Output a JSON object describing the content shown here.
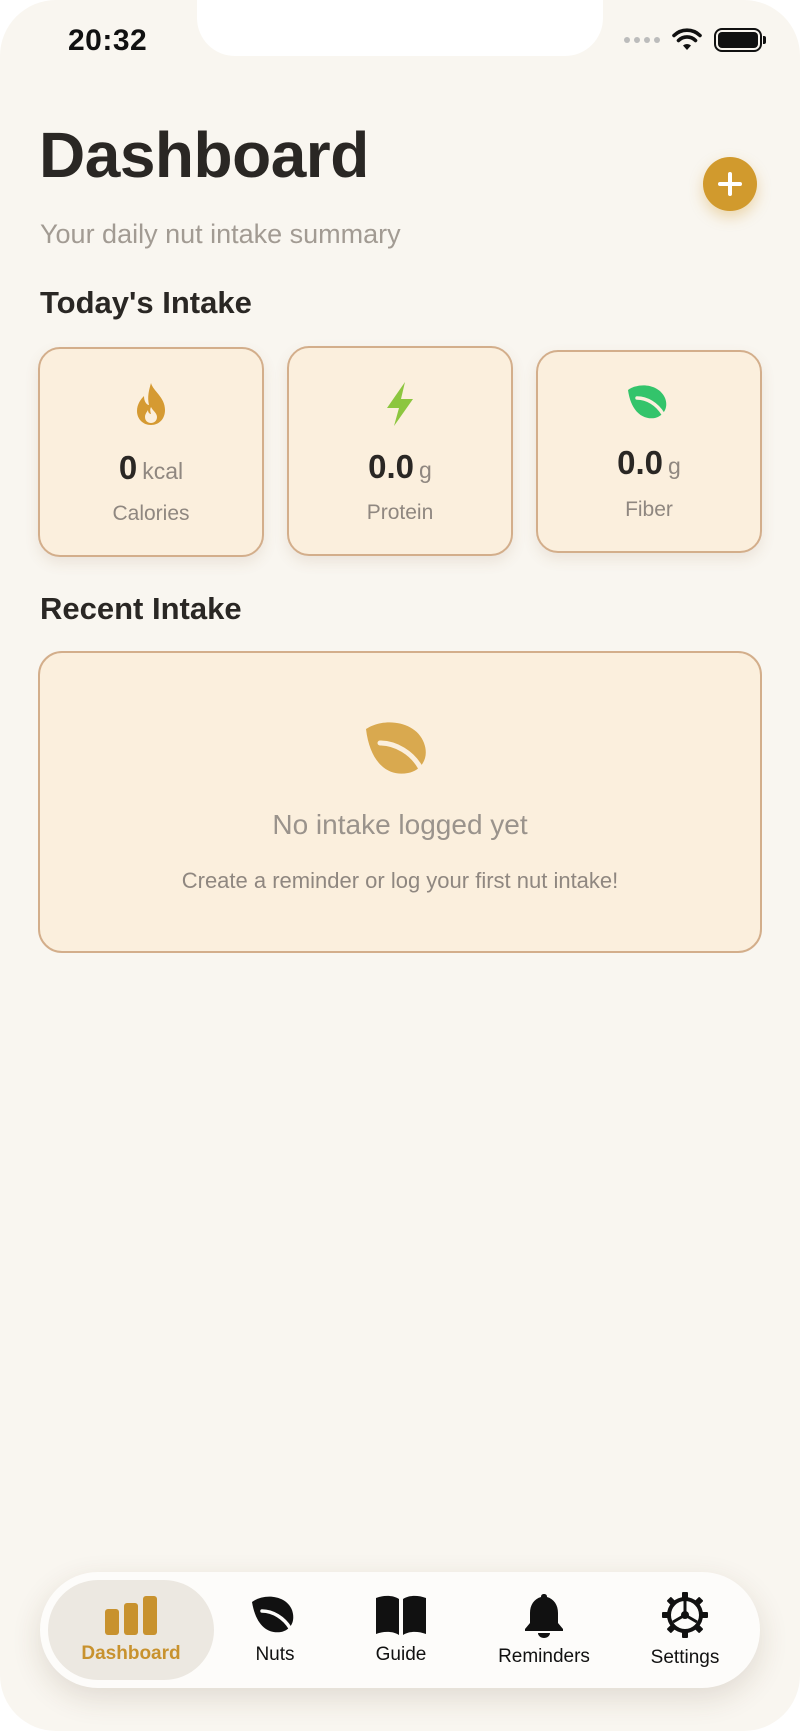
{
  "status_bar": {
    "time": "20:32"
  },
  "header": {
    "title": "Dashboard",
    "subtitle": "Your daily nut intake summary",
    "add_icon": "plus-icon"
  },
  "today": {
    "title": "Today's Intake",
    "cards": [
      {
        "icon": "flame-icon",
        "icon_color": "#d59a32",
        "value": "0",
        "unit": "kcal",
        "label": "Calories"
      },
      {
        "icon": "bolt-icon",
        "icon_color": "#8cc63f",
        "value": "0.0",
        "unit": "g",
        "label": "Protein"
      },
      {
        "icon": "leaf-icon",
        "icon_color": "#33c46b",
        "value": "0.0",
        "unit": "g",
        "label": "Fiber"
      }
    ]
  },
  "recent": {
    "title": "Recent Intake",
    "empty_title": "No intake logged yet",
    "empty_text": "Create a reminder or log your first nut intake!",
    "empty_icon": "leaf-icon"
  },
  "tabs": [
    {
      "label": "Dashboard",
      "icon": "chart-bars-icon",
      "active": true
    },
    {
      "label": "Nuts",
      "icon": "leaf-icon",
      "active": false
    },
    {
      "label": "Guide",
      "icon": "book-icon",
      "active": false
    },
    {
      "label": "Reminders",
      "icon": "bell-icon",
      "active": false
    },
    {
      "label": "Settings",
      "icon": "gear-icon",
      "active": false
    }
  ],
  "colors": {
    "accent": "#d19a2d",
    "card_bg": "#fbefdd",
    "card_border": "#d3ae8b",
    "background": "#f9f6f0"
  }
}
